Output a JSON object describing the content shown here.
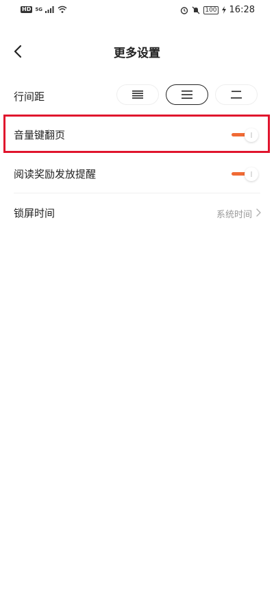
{
  "status_bar": {
    "left_badge": "HD",
    "network": "5G",
    "battery": "100",
    "time": "16:28",
    "icons": [
      "signal-icon",
      "wifi-icon",
      "alarm-icon",
      "mute-icon",
      "battery-icon",
      "charging-icon"
    ]
  },
  "header": {
    "back_icon": "back-arrow-icon",
    "title": "更多设置"
  },
  "settings": {
    "line_spacing": {
      "label": "行间距",
      "options": [
        "compact",
        "standard",
        "loose"
      ],
      "selected": "standard"
    },
    "volume_page_turn": {
      "label": "音量键翻页",
      "enabled": true
    },
    "reading_reward_reminder": {
      "label": "阅读奖励发放提醒",
      "enabled": true
    },
    "lock_screen_time": {
      "label": "锁屏时间",
      "value": "系统时间"
    }
  },
  "colors": {
    "accent": "#f06a34",
    "highlight": "#e0142d",
    "secondary_text": "#999999"
  }
}
